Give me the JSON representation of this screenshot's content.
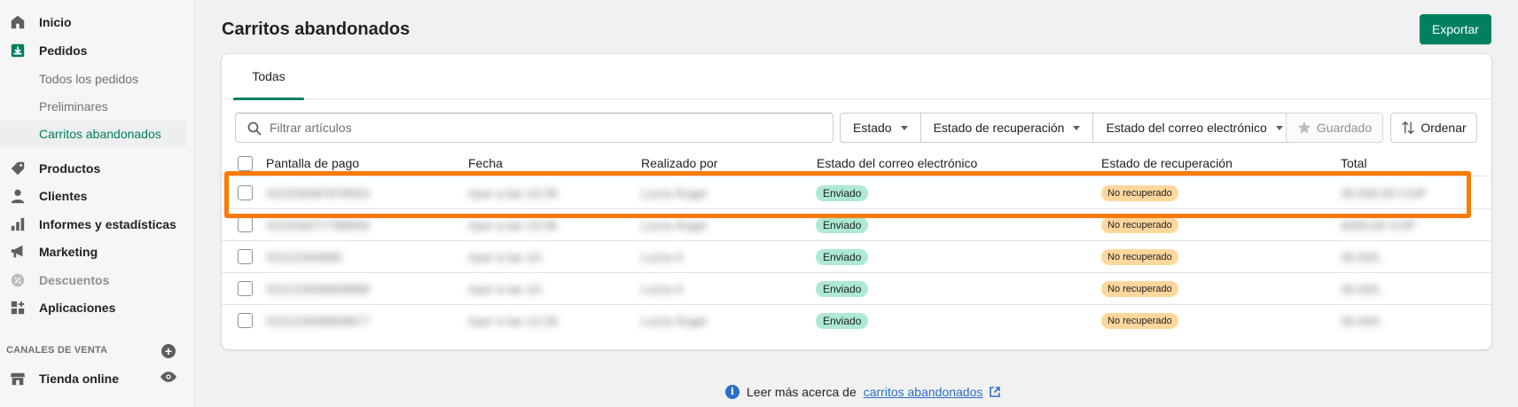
{
  "sidebar": {
    "items": [
      {
        "label": "Inicio",
        "icon": "home-icon"
      },
      {
        "label": "Pedidos",
        "icon": "orders-icon"
      },
      {
        "label": "Productos",
        "icon": "tag-icon"
      },
      {
        "label": "Clientes",
        "icon": "person-icon"
      },
      {
        "label": "Informes y estadísticas",
        "icon": "bar-chart-icon"
      },
      {
        "label": "Marketing",
        "icon": "megaphone-icon"
      },
      {
        "label": "Descuentos",
        "icon": "discount-icon"
      },
      {
        "label": "Aplicaciones",
        "icon": "apps-icon"
      }
    ],
    "orders_sub": [
      "Todos los pedidos",
      "Preliminares",
      "Carritos abandonados"
    ],
    "active_sub": "Carritos abandonados",
    "sales_channels_title": "CANALES DE VENTA",
    "online_store": "Tienda online"
  },
  "page": {
    "title": "Carritos abandonados",
    "export_label": "Exportar"
  },
  "tabs": [
    {
      "label": "Todas"
    }
  ],
  "toolbar": {
    "search_placeholder": "Filtrar artículos",
    "filters": [
      "Estado",
      "Estado de recuperación",
      "Estado del correo electrónico"
    ],
    "saved_label": "Guardado",
    "sort_label": "Ordenar"
  },
  "table": {
    "headers": [
      "Pantalla de pago",
      "Fecha",
      "Realizado por",
      "Estado del correo electrónico",
      "Estado de recuperación",
      "Total"
    ],
    "rows": [
      {
        "checkout": "#22204087878553",
        "date": "Ayer a las 15:35",
        "customer": "Lucía Ángel",
        "email_status": "Enviado",
        "recovery_status": "No recuperado",
        "total": "30.000,00 COP"
      },
      {
        "checkout": "#22204077788655",
        "date": "Ayer a las 15:06",
        "customer": "Lucía Ángel",
        "email_status": "Enviado",
        "recovery_status": "No recuperado",
        "total": "4000,00 COP"
      },
      {
        "checkout": "#2212300880",
        "date": "Ayer a las 10:",
        "customer": "Lucía Á",
        "email_status": "Enviado",
        "recovery_status": "No recuperado",
        "total": "30.000,"
      },
      {
        "checkout": "#22123008808888",
        "date": "Ayer a las 10:",
        "customer": "Lucía Á",
        "email_status": "Enviado",
        "recovery_status": "No recuperado",
        "total": "30.000,"
      },
      {
        "checkout": "#22123008808877",
        "date": "Ayer a las 12:28",
        "customer": "Lucía Ángel",
        "email_status": "Enviado",
        "recovery_status": "No recuperado",
        "total": "30.000,"
      }
    ]
  },
  "footer": {
    "text": "Leer más acerca de",
    "link": "carritos abandonados"
  },
  "colors": {
    "accent": "#008060",
    "highlight": "#ff7a00",
    "badge_sent": "#aee9d1",
    "badge_not_recovered": "#ffd79d",
    "link": "#2c6ecb"
  }
}
